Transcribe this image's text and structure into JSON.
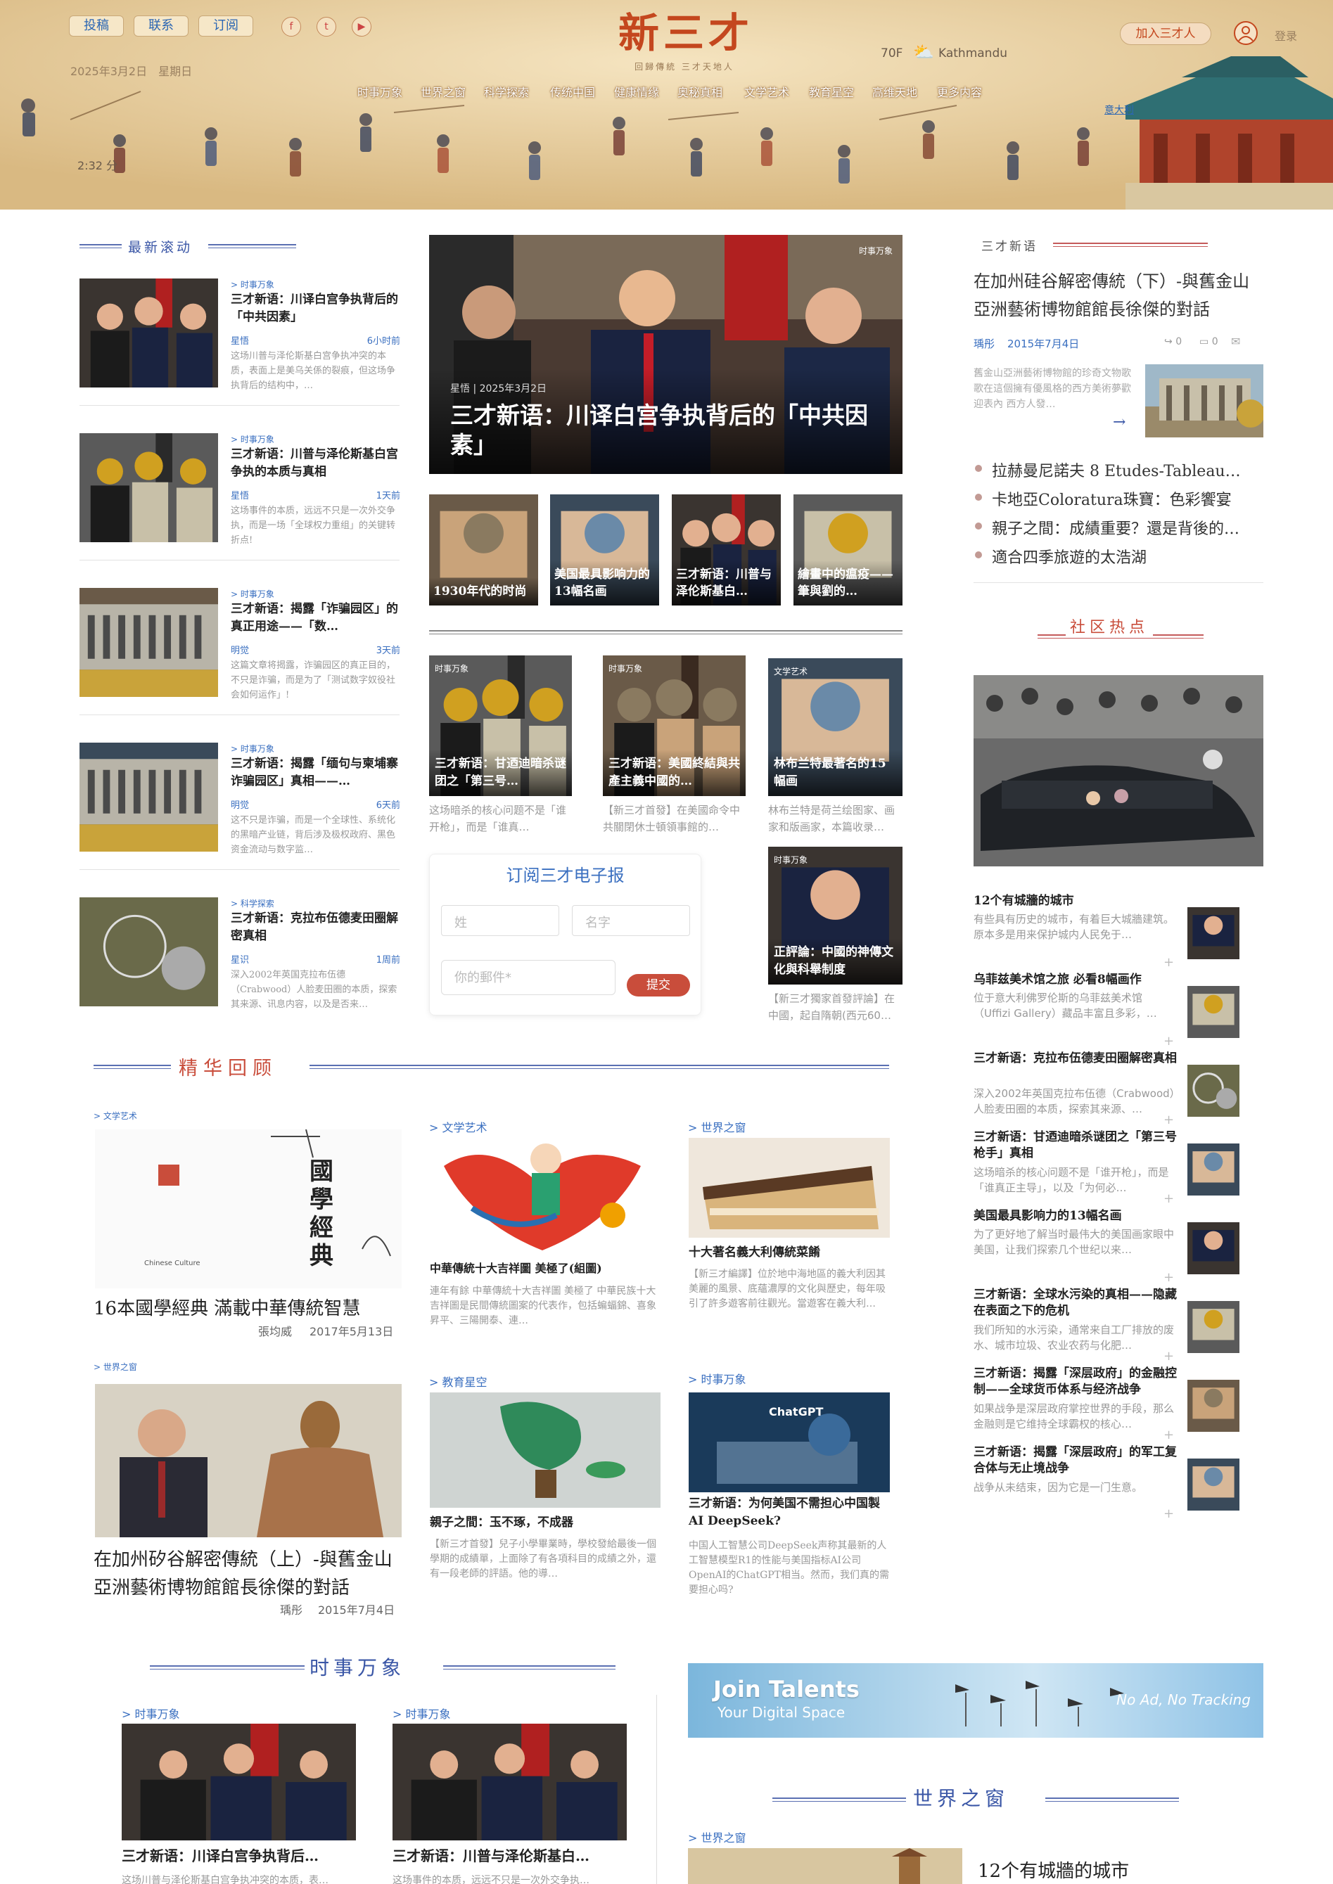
{
  "header": {
    "buttons": [
      "投稿",
      "联系",
      "订阅"
    ],
    "social": [
      {
        "icon": "facebook-icon",
        "glyph": "f"
      },
      {
        "icon": "twitter-icon",
        "glyph": "t"
      },
      {
        "icon": "youtube-icon",
        "glyph": "▶"
      }
    ],
    "date": "2025年3月2日　星期日",
    "logo": "新三才",
    "tagline": "回歸傳統  三才天地人",
    "weather": {
      "temp": "70F",
      "icon": "sun-cloud-icon",
      "city": "Kathmandu"
    },
    "join": "加入三才人",
    "login": "登录",
    "nav": [
      "时事万象",
      "世界之窗",
      "科学探索",
      "传统中国",
      "健康情缘",
      "奥秘真相",
      "文学艺术",
      "教育星空",
      "高维天地",
      "更多内容"
    ],
    "location_link": "意大利",
    "audio_time": "2:32 分",
    "colors": {
      "logo": "#c4471e",
      "link": "#2b66b3"
    }
  },
  "latest": {
    "title": "最新滚动",
    "items": [
      {
        "cat": "> 时事万象",
        "title": "三才新语：川译白宫争执背后的「中共因素」",
        "author": "星悟",
        "time": "6小时前",
        "excerpt": "这场川普与泽伦斯基白宫争执冲突的本质，表面上是美乌关係的裂痕，但这场争执背后的结构中，…"
      },
      {
        "cat": "> 时事万象",
        "title": "三才新语：川普与泽伦斯基白宫争执的本质与真相",
        "author": "星悟",
        "time": "1天前",
        "excerpt": "这场事件的本质，远远不只是一次外交争执，而是一场「全球权力重组」的关键转折点!"
      },
      {
        "cat": "> 时事万象",
        "title": "三才新语：揭露「诈骗园区」的真正用途——「数…",
        "author": "明觉",
        "time": "3天前",
        "excerpt": "这篇文章将揭露，诈骗园区的真正目的，不只是诈骗，而是为了「测试数字奴役社会如何运作」!"
      },
      {
        "cat": "> 时事万象",
        "title": "三才新语：揭露「缅句与柬埔寨诈骗园区」真相——…",
        "author": "明觉",
        "time": "6天前",
        "excerpt": "这不只是诈骗，而是一个全球性、系统化的黑暗产业链，背后涉及极权政府、黑色资金流动与数字监…"
      },
      {
        "cat": "> 科学探索",
        "title": "三才新语：克拉布伍德麦田圈解密真相",
        "author": "星识",
        "time": "1周前",
        "excerpt": "深入2002年英国克拉布伍德（Crabwood）人脸麦田圈的本质，探索其来源、讯息内容，以及是否来…"
      }
    ]
  },
  "featured": {
    "tag": "时事万象",
    "author_date": "星悟 | 2025年3月2日",
    "title": "三才新语：川译白宫争执背后的「中共因素」",
    "thumbs": [
      "1930年代的时尚",
      "美国最具影响力的13幅名画",
      "三才新语：川普与泽伦斯基白…",
      "繪畫中的瘟疫——筆與劉的…"
    ]
  },
  "mid_cards": [
    {
      "tag": "时事万象",
      "title": "三才新语：甘迺迪暗杀谜团之「第三号…",
      "excerpt": "这场暗杀的核心问题不是「谁开枪」，而是「谁真…"
    },
    {
      "tag": "时事万象",
      "title": "三才新语：美國終結與共產主義中國的…",
      "excerpt": "【新三才首發】在美國命令中共關閉休士頓領事館的…"
    },
    {
      "tag": "文学艺术",
      "title": "林布兰特最著名的15幅画",
      "excerpt": "林布兰特是荷兰绘图家、画家和版画家，本篇收录…"
    },
    {
      "tag": "时事万象",
      "title": "正評論：中國的神傳文化與科舉制度",
      "excerpt": "【新三才獨家首發評論】在中國，起自隋朝(西元60…"
    }
  ],
  "subscribe": {
    "title": "订阅三才电子报",
    "first": "姓",
    "last": "名字",
    "email": "你的郵件*",
    "button": "提交"
  },
  "column": {
    "title": "三才新语",
    "main_title": "在加州硅谷解密傳統（下）-與舊金山亞洲藝術博物館館長徐傑的對話",
    "author": "瑀彤",
    "date": "2015年7月4日",
    "shares": "0",
    "comments": "0",
    "excerpt": "舊金山亞洲藝術博物館的珍奇文物歌歌在這個擁有優風格的西方美術夢歡迎表內  西方人發…",
    "list": [
      "拉赫曼尼諾夫 8 Etudes-Tableau…",
      "卡地亞Coloratura珠寶：色彩饗宴",
      "親子之間：成績重要？還是背後的…",
      "適合四季旅遊的太浩湖"
    ]
  },
  "community": {
    "title": "社区热点",
    "items": [
      {
        "title": "12个有城牆的城市",
        "excerpt": "有些具有历史的城市，有着巨大城牆建筑。原本多是用来保护城内人民免于…"
      },
      {
        "title": "乌菲兹美术馆之旅 必看8幅画作",
        "excerpt": "位于意大利佛罗伦斯的乌菲兹美术馆（Uffizi Gallery）藏品丰富且多彩，…"
      },
      {
        "title": "三才新语：克拉布伍德麦田圈解密真相",
        "excerpt": "深入2002年英国克拉布伍德（Crabwood）人脸麦田圈的本质，探索其来源、…"
      },
      {
        "title": "三才新语：甘迺迪暗杀谜团之「第三号枪手」真相",
        "excerpt": "这场暗杀的核心问题不是「谁开枪」，而是「谁真正主导」，以及「为何必…"
      },
      {
        "title": "美国最具影响力的13幅名画",
        "excerpt": "为了更好地了解当时最伟大的美国画家眼中美国，让我们探索几个世纪以来…"
      },
      {
        "title": "三才新语：全球水污染的真相——隐藏在表面之下的危机",
        "excerpt": "我们所知的水污染，通常来自工厂排放的废水、城市垃圾、农业农药与化肥…"
      },
      {
        "title": "三才新语：揭露「深层政府」的金融控制——全球货币体系与经济战争",
        "excerpt": "如果战争是深层政府掌控世界的手段，那么金融则是它维持全球霸权的核心…"
      },
      {
        "title": "三才新语：揭露「深层政府」的军工复合体与无止境战争",
        "excerpt": "战争从未结束，因为它是一门生意。"
      }
    ]
  },
  "review": {
    "title": "精华回顾",
    "items": [
      {
        "cat": "> 文学艺术",
        "title": "16本國學經典 滿載中華傳統智慧",
        "author": "張均威",
        "date": "2017年5月13日",
        "img_text": "國學經典",
        "img_sub": "Chinese Culture"
      },
      {
        "cat": "> 文学艺术",
        "title": "中華傳統十大吉祥圖 美極了(組圖)",
        "excerpt": "連年有餘 中華傳統十大吉祥圖 美極了 中華民族十大吉祥圖是民間傳統圖案的代表作，包括蝙蝠錦、喜象昇平、三陽開泰、連…"
      },
      {
        "cat": "> 世界之窗",
        "title": "十大著名義大利傳統菜餚",
        "excerpt": "【新三才編譯】位於地中海地區的義大利因其美麗的風景、底蘊濃厚的文化與歷史，每年吸引了許多遊客前往觀光。當遊客在義大利…"
      },
      {
        "cat": "> 世界之窗",
        "title": "在加州矽谷解密傳統（上）-與舊金山亞洲藝術博物館館長徐傑的對話",
        "author": "瑀彤",
        "date": "2015年7月4日"
      },
      {
        "cat": "> 教育星空",
        "title": "親子之間：玉不琢，不成器",
        "excerpt": "【新三才首發】兒子小學畢業時，學校發給最後一個學期的成績單，上面除了有各項科目的成績之外，還有一段老師的評語。他的導…"
      },
      {
        "cat": "> 时事万象",
        "title": "三才新语：为何美国不需担心中国製AI DeepSeek?",
        "excerpt": "中国人工智慧公司DeepSeek声称其最新的人工智慧模型R1的性能与美国指标AI公司OpenAI的ChatGPT相当。然而，我们真的需要担心吗?",
        "img_text": "ChatGPT"
      }
    ]
  },
  "current": {
    "title": "时事万象",
    "items": [
      {
        "cat": "> 时事万象",
        "title": "三才新语：川译白宫争执背后…",
        "excerpt": "这场川普与泽伦斯基白宫争执冲突的本质，表…"
      },
      {
        "cat": "> 时事万象",
        "title": "三才新语：川普与泽伦斯基白…",
        "excerpt": "这场事件的本质，远远不只是一次外交争执…"
      }
    ]
  },
  "banner": {
    "title": "Join Talents",
    "sub": "Your Digital Space",
    "right": "No Ad, No Tracking"
  },
  "world": {
    "title": "世界之窗",
    "cat": "> 世界之窗",
    "item": "12个有城牆的城市"
  }
}
